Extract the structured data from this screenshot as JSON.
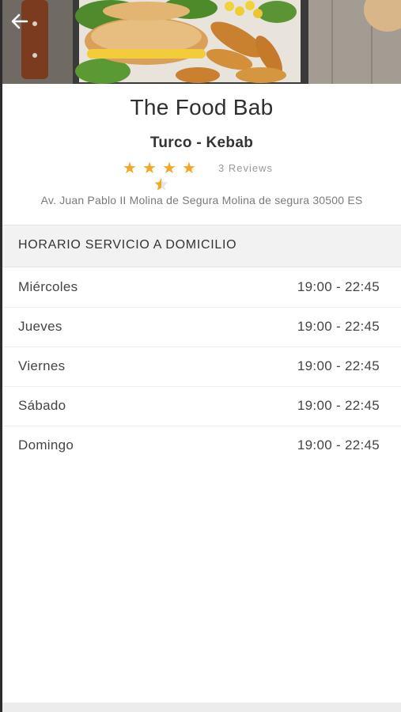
{
  "header": {
    "back_icon": "arrow-left-icon",
    "hero_image": "food-photo"
  },
  "restaurant": {
    "name": "The Food Bab",
    "category": "Turco - Kebab",
    "rating": 4.5,
    "rating_max": 5,
    "reviews_label": "3 Reviews",
    "address": "Av. Juan Pablo II Molina de Segura Molina de segura 30500 ES"
  },
  "colors": {
    "star": "#f5a623",
    "section_bg": "#f2f2f2"
  },
  "schedule": {
    "title": "HORARIO SERVICIO A DOMICILIO",
    "rows": [
      {
        "day": "Miércoles",
        "hours": "19:00 - 22:45"
      },
      {
        "day": "Jueves",
        "hours": "19:00 - 22:45"
      },
      {
        "day": "Viernes",
        "hours": "19:00 - 22:45"
      },
      {
        "day": "Sábado",
        "hours": "19:00 - 22:45"
      },
      {
        "day": "Domingo",
        "hours": "19:00 - 22:45"
      }
    ]
  }
}
